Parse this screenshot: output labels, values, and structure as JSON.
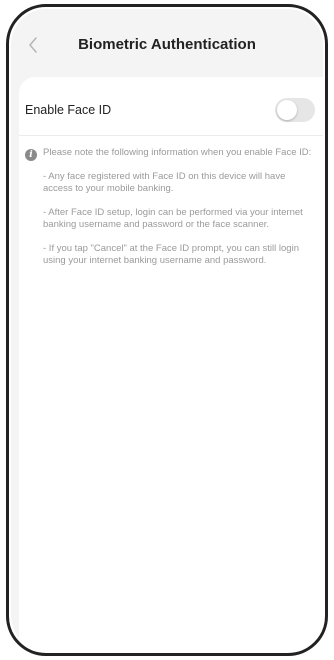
{
  "nav": {
    "title": "Biometric Authentication",
    "back_icon": "chevron-left-icon"
  },
  "setting": {
    "label": "Enable Face ID",
    "enabled": false
  },
  "info": {
    "icon": "info-icon",
    "intro": "Please note the following information when you enable Face ID:",
    "bullets": [
      "-  Any face registered with Face ID on this device will have access to your mobile banking.",
      "-  After Face ID setup, login can be performed via your internet banking username and password or the face scanner.",
      "-  If you tap \"Cancel\" at the Face ID prompt, you can still login using your internet banking username and password."
    ]
  },
  "colors": {
    "background": "#f4f4f4",
    "card": "#ffffff",
    "toggle_off": "#e6e6e6",
    "info_text": "#9a9a9a"
  }
}
